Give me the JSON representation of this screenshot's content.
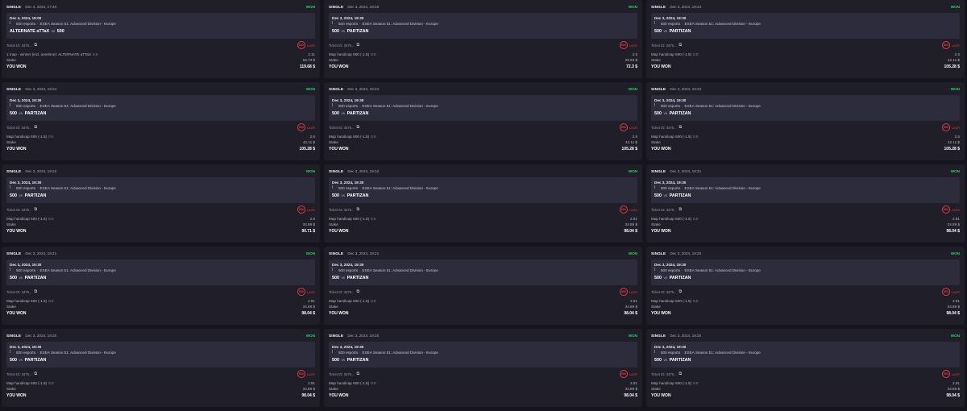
{
  "bets": [
    {
      "type": "SINGLE",
      "placed": "Dec 4, 2024, 17:40",
      "result": "WON",
      "event_time": "Dec 4, 2024, 18:00",
      "sport": "500 esports",
      "league": "ESEA Season 51: Advanced Division - Europe",
      "team1": "ALTERNATE aTTaX",
      "vs": "vs",
      "team2": "500",
      "ticket": "Ticket ID: 3475...",
      "boost": "500",
      "boost_label": "LAZR",
      "selection": "1 map - winner (incl. overtime): ALTERNATE aTTaX",
      "selection_extra": "0.0",
      "odds": "2.11",
      "stake_label": "Stake",
      "stake": "56.73 $",
      "payout_label": "YOU WON",
      "payout": "119.68 $"
    },
    {
      "type": "SINGLE",
      "placed": "Dec 3, 2024, 19:25",
      "result": "WON",
      "event_time": "Dec 3, 2024, 19:30",
      "sport": "500 esports",
      "league": "ESEA Season 51: Advanced Division - Europe",
      "team1": "500",
      "vs": "vs",
      "team2": "PARTIZAN",
      "ticket": "Ticket ID: 3475...",
      "boost": "500",
      "boost_label": "LAZR",
      "selection": "Map handicap 500 (-1.5)",
      "selection_extra": "0.0",
      "odds": "2.5",
      "stake_label": "Stake",
      "stake": "28.93 $",
      "payout_label": "YOU WON",
      "payout": "72.3 $"
    },
    {
      "type": "SINGLE",
      "placed": "Dec 3, 2024, 19:24",
      "result": "WON",
      "event_time": "Dec 3, 2024, 19:30",
      "sport": "500 esports",
      "league": "ESEA Season 51: Advanced Division - Europe",
      "team1": "500",
      "vs": "vs",
      "team2": "PARTIZAN",
      "ticket": "Ticket ID: 3475...",
      "boost": "500",
      "boost_label": "LAZR",
      "selection": "Map handicap 500 (-1.5)",
      "selection_extra": "0.0",
      "odds": "2.5",
      "stake_label": "Stake",
      "stake": "42.11 $",
      "payout_label": "YOU WON",
      "payout": "105.28 $"
    },
    {
      "type": "SINGLE",
      "placed": "Dec 3, 2024, 19:24",
      "result": "WON",
      "event_time": "Dec 3, 2024, 19:30",
      "sport": "500 esports",
      "league": "ESEA Season 51: Advanced Division - Europe",
      "team1": "500",
      "vs": "vs",
      "team2": "PARTIZAN",
      "ticket": "Ticket ID: 3475...",
      "boost": "500",
      "boost_label": "LAZR",
      "selection": "Map handicap 500 (-1.5)",
      "selection_extra": "0.0",
      "odds": "2.5",
      "stake_label": "Stake",
      "stake": "42.11 $",
      "payout_label": "YOU WON",
      "payout": "105.28 $"
    },
    {
      "type": "SINGLE",
      "placed": "Dec 3, 2024, 19:24",
      "result": "WON",
      "event_time": "Dec 3, 2024, 19:30",
      "sport": "500 esports",
      "league": "ESEA Season 51: Advanced Division - Europe",
      "team1": "500",
      "vs": "vs",
      "team2": "PARTIZAN",
      "ticket": "Ticket ID: 3475...",
      "boost": "500",
      "boost_label": "LAZR",
      "selection": "Map handicap 500 (-1.5)",
      "selection_extra": "0.0",
      "odds": "2.5",
      "stake_label": "Stake",
      "stake": "42.11 $",
      "payout_label": "YOU WON",
      "payout": "105.28 $"
    },
    {
      "type": "SINGLE",
      "placed": "Dec 3, 2024, 19:23",
      "result": "WON",
      "event_time": "Dec 3, 2024, 19:30",
      "sport": "500 esports",
      "league": "ESEA Season 51: Advanced Division - Europe",
      "team1": "500",
      "vs": "vs",
      "team2": "PARTIZAN",
      "ticket": "Ticket ID: 3475...",
      "boost": "500",
      "boost_label": "LAZR",
      "selection": "Map handicap 500 (-1.5)",
      "selection_extra": "0.0",
      "odds": "2.5",
      "stake_label": "Stake",
      "stake": "42.11 $",
      "payout_label": "YOU WON",
      "payout": "105.28 $"
    },
    {
      "type": "SINGLE",
      "placed": "Dec 3, 2024, 19:22",
      "result": "WON",
      "event_time": "Dec 3, 2024, 19:30",
      "sport": "500 esports",
      "league": "ESEA Season 51: Advanced Division - Europe",
      "team1": "500",
      "vs": "vs",
      "team2": "PARTIZAN",
      "ticket": "Ticket ID: 3475...",
      "boost": "500",
      "boost_label": "LAZR",
      "selection": "Map handicap 500 (-1.5)",
      "selection_extra": "0.0",
      "odds": "2.6",
      "stake_label": "Stake",
      "stake": "34.89 $",
      "payout_label": "YOU WON",
      "payout": "90.71 $"
    },
    {
      "type": "SINGLE",
      "placed": "Dec 3, 2024, 19:22",
      "result": "WON",
      "event_time": "Dec 3, 2024, 19:30",
      "sport": "500 esports",
      "league": "ESEA Season 51: Advanced Division - Europe",
      "team1": "500",
      "vs": "vs",
      "team2": "PARTIZAN",
      "ticket": "Ticket ID: 3475...",
      "boost": "500",
      "boost_label": "LAZR",
      "selection": "Map handicap 500 (-1.5)",
      "selection_extra": "0.0",
      "odds": "2.81",
      "stake_label": "Stake",
      "stake": "34.89 $",
      "payout_label": "YOU WON",
      "payout": "98.04 $"
    },
    {
      "type": "SINGLE",
      "placed": "Dec 3, 2024, 19:21",
      "result": "WON",
      "event_time": "Dec 3, 2024, 19:30",
      "sport": "500 esports",
      "league": "ESEA Season 51: Advanced Division - Europe",
      "team1": "500",
      "vs": "vs",
      "team2": "PARTIZAN",
      "ticket": "Ticket ID: 3475...",
      "boost": "500",
      "boost_label": "LAZR",
      "selection": "Map handicap 500 (-1.5)",
      "selection_extra": "0.0",
      "odds": "2.81",
      "stake_label": "Stake",
      "stake": "34.89 $",
      "payout_label": "YOU WON",
      "payout": "98.04 $"
    },
    {
      "type": "SINGLE",
      "placed": "Dec 3, 2024, 19:21",
      "result": "WON",
      "event_time": "Dec 3, 2024, 19:30",
      "sport": "500 esports",
      "league": "ESEA Season 51: Advanced Division - Europe",
      "team1": "500",
      "vs": "vs",
      "team2": "PARTIZAN",
      "ticket": "Ticket ID: 3475...",
      "boost": "500",
      "boost_label": "LAZR",
      "selection": "Map handicap 500 (-1.5)",
      "selection_extra": "0.0",
      "odds": "2.81",
      "stake_label": "Stake",
      "stake": "34.89 $",
      "payout_label": "YOU WON",
      "payout": "98.04 $"
    },
    {
      "type": "SINGLE",
      "placed": "Dec 3, 2024, 19:21",
      "result": "WON",
      "event_time": "Dec 3, 2024, 19:30",
      "sport": "500 esports",
      "league": "ESEA Season 51: Advanced Division - Europe",
      "team1": "500",
      "vs": "vs",
      "team2": "PARTIZAN",
      "ticket": "Ticket ID: 3475...",
      "boost": "500",
      "boost_label": "LAZR",
      "selection": "Map handicap 500 (-1.5)",
      "selection_extra": "0.0",
      "odds": "2.81",
      "stake_label": "Stake",
      "stake": "34.89 $",
      "payout_label": "YOU WON",
      "payout": "98.04 $"
    },
    {
      "type": "SINGLE",
      "placed": "Dec 3, 2024, 19:20",
      "result": "WON",
      "event_time": "Dec 3, 2024, 19:30",
      "sport": "500 esports",
      "league": "ESEA Season 51: Advanced Division - Europe",
      "team1": "500",
      "vs": "vs",
      "team2": "PARTIZAN",
      "ticket": "Ticket ID: 3475...",
      "boost": "500",
      "boost_label": "LAZR",
      "selection": "Map handicap 500 (-1.5)",
      "selection_extra": "0.0",
      "odds": "2.81",
      "stake_label": "Stake",
      "stake": "34.89 $",
      "payout_label": "YOU WON",
      "payout": "98.04 $"
    },
    {
      "type": "SINGLE",
      "placed": "Dec 3, 2024, 19:20",
      "result": "WON",
      "event_time": "Dec 3, 2024, 19:30",
      "sport": "500 esports",
      "league": "ESEA Season 51: Advanced Division - Europe",
      "team1": "500",
      "vs": "vs",
      "team2": "PARTIZAN",
      "ticket": "Ticket ID: 3475...",
      "boost": "500",
      "boost_label": "LAZR",
      "selection": "Map handicap 500 (-1.5)",
      "selection_extra": "0.0",
      "odds": "2.81",
      "stake_label": "Stake",
      "stake": "34.89 $",
      "payout_label": "YOU WON",
      "payout": "98.04 $"
    },
    {
      "type": "SINGLE",
      "placed": "Dec 3, 2024, 19:20",
      "result": "WON",
      "event_time": "Dec 3, 2024, 19:30",
      "sport": "500 esports",
      "league": "ESEA Season 51: Advanced Division - Europe",
      "team1": "500",
      "vs": "vs",
      "team2": "PARTIZAN",
      "ticket": "Ticket ID: 3475...",
      "boost": "500",
      "boost_label": "LAZR",
      "selection": "Map handicap 500 (-1.5)",
      "selection_extra": "0.0",
      "odds": "2.81",
      "stake_label": "Stake",
      "stake": "34.89 $",
      "payout_label": "YOU WON",
      "payout": "98.04 $"
    },
    {
      "type": "SINGLE",
      "placed": "Dec 3, 2024, 19:20",
      "result": "WON",
      "event_time": "Dec 3, 2024, 19:30",
      "sport": "500 esports",
      "league": "ESEA Season 51: Advanced Division - Europe",
      "team1": "500",
      "vs": "vs",
      "team2": "PARTIZAN",
      "ticket": "Ticket ID: 3475...",
      "boost": "500",
      "boost_label": "LAZR",
      "selection": "Map handicap 500 (-1.5)",
      "selection_extra": "0.0",
      "odds": "2.81",
      "stake_label": "Stake",
      "stake": "34.89 $",
      "payout_label": "YOU WON",
      "payout": "98.04 $"
    }
  ],
  "colors": {
    "won": "#2fd35a",
    "boost": "#e23b43",
    "card": "#1f1e29",
    "event_box": "#2d2c3c"
  },
  "icons": {
    "game": "cs-game-icon",
    "copy": "copy-icon",
    "boost": "boost-badge-icon"
  }
}
